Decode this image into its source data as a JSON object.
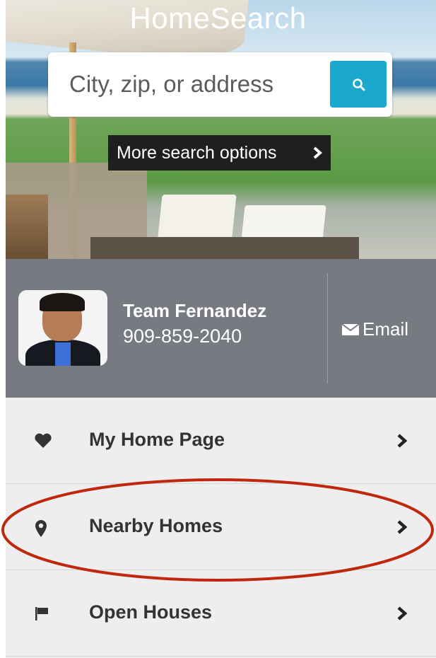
{
  "app": {
    "title": "HomeSearch"
  },
  "search": {
    "placeholder": "City, zip, or address",
    "button_icon": "search-icon",
    "more_options_label": "More search options"
  },
  "agent": {
    "name": "Team Fernandez",
    "phone": "909-859-2040",
    "email_label": "Email",
    "email_icon": "envelope-icon"
  },
  "menu": {
    "items": [
      {
        "label": "My Home Page",
        "icon": "heart-icon"
      },
      {
        "label": "Nearby Homes",
        "icon": "map-pin-icon",
        "highlighted": true
      },
      {
        "label": "Open Houses",
        "icon": "flag-icon"
      }
    ]
  },
  "colors": {
    "accent": "#1aa9cc",
    "agent_panel": "#777b81",
    "menu_bg": "#eeeeee",
    "highlight": "#c0280e"
  }
}
